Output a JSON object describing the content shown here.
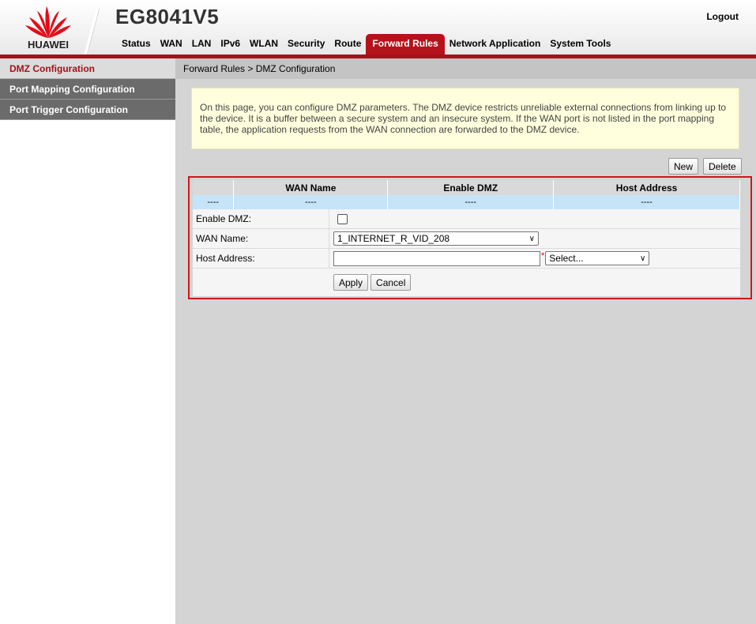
{
  "header": {
    "brand": "HUAWEI",
    "model": "EG8041V5",
    "logout_label": "Logout",
    "nav": [
      {
        "label": "Status",
        "active": false
      },
      {
        "label": "WAN",
        "active": false
      },
      {
        "label": "LAN",
        "active": false
      },
      {
        "label": "IPv6",
        "active": false
      },
      {
        "label": "WLAN",
        "active": false
      },
      {
        "label": "Security",
        "active": false
      },
      {
        "label": "Route",
        "active": false
      },
      {
        "label": "Forward Rules",
        "active": true
      },
      {
        "label": "Network Application",
        "active": false
      },
      {
        "label": "System Tools",
        "active": false
      }
    ]
  },
  "sidebar": {
    "items": [
      {
        "label": "DMZ Configuration",
        "active": true
      },
      {
        "label": "Port Mapping Configuration",
        "active": false
      },
      {
        "label": "Port Trigger Configuration",
        "active": false
      }
    ]
  },
  "main": {
    "breadcrumb": "Forward Rules > DMZ Configuration",
    "info_text": "On this page, you can configure DMZ parameters. The DMZ device restricts unreliable external connections from linking up to the device. It is a buffer between a secure system and an insecure system. If the WAN port is not listed in the port mapping table, the application requests from the WAN connection are forwarded to the DMZ device.",
    "new_label": "New",
    "delete_label": "Delete",
    "table": {
      "headers": [
        "",
        "WAN Name",
        "Enable DMZ",
        "Host Address"
      ],
      "rows": [
        [
          "----",
          "----",
          "----",
          "----"
        ]
      ]
    },
    "form": {
      "enable_dmz_label": "Enable DMZ:",
      "enable_dmz_checked": false,
      "wan_name_label": "WAN Name:",
      "wan_name_value": "1_INTERNET_R_VID_208",
      "host_address_label": "Host Address:",
      "host_address_value": "",
      "required_mark": "*",
      "host_select_value": "Select...",
      "apply_label": "Apply",
      "cancel_label": "Cancel"
    }
  },
  "colors": {
    "brand_red": "#a3121a",
    "active_tab": "#b5121b",
    "info_bg": "#ffffdd",
    "table_row": "#c5e4f8",
    "highlight": "#d0151c"
  }
}
